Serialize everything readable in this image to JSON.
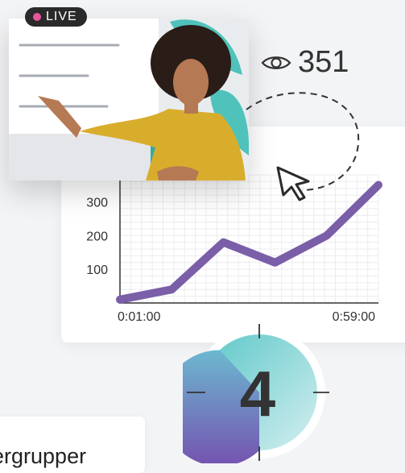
{
  "live_badge": {
    "label": "LIVE",
    "dot_color": "#e8549b"
  },
  "viewers": {
    "icon": "eye-icon",
    "count": "351"
  },
  "chart_data": {
    "type": "line",
    "x_tick_labels": [
      "0:01:00",
      "0:59:00"
    ],
    "y_ticks": [
      100,
      200,
      300
    ],
    "ylim": [
      0,
      380
    ],
    "grid": true,
    "series": [
      {
        "color": "#7a5ea8",
        "values": [
          10,
          40,
          180,
          120,
          200,
          350
        ]
      }
    ]
  },
  "countdown": {
    "value": "4",
    "progress": 0.62
  },
  "bottom_card": {
    "text": "ergrupper"
  },
  "colors": {
    "accent": "#7a5ea8",
    "teal": "#62cfcf"
  }
}
